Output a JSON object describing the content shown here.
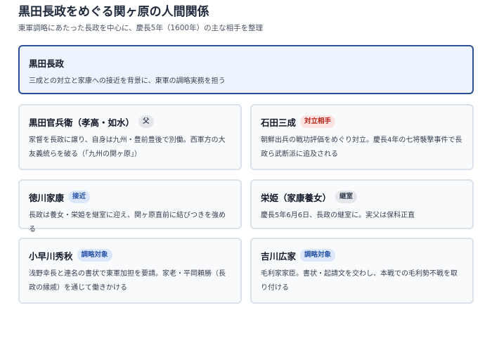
{
  "header": {
    "title": "黒田長政をめぐる関ヶ原の人間関係",
    "subtitle": "東軍調略にあたった長政を中心に、慶長5年（1600年）の主な相手を整理"
  },
  "center": {
    "name": "黒田長政",
    "desc": "三成との対立と家康への接近を背景に、東軍の調略実務を担う"
  },
  "people": [
    {
      "name": "黒田官兵衛（孝高・如水）",
      "badge": "父",
      "desc": "家督を長政に譲り、自身は九州・豊前豊後で別働。西軍方の大友義統らを破る（「九州の関ヶ原」）"
    },
    {
      "name": "石田三成",
      "badge": "対立相手",
      "desc": "朝鮮出兵の戦功評価をめぐり対立。慶長4年の七将襲撃事件で長政ら武断派に追及される"
    },
    {
      "name": "徳川家康",
      "badge": "接近",
      "desc": "長政は養女・栄姫を継室に迎え、関ヶ原直前に結びつきを強める"
    },
    {
      "name": "栄姫（家康養女）",
      "badge": "継室",
      "desc": "慶長5年6月6日、長政の継室に。実父は保科正直"
    },
    {
      "name": "小早川秀秋",
      "badge": "調略対象",
      "desc": "浅野幸長と連名の書状で東軍加担を要請。家老・平岡頼勝（長政の縁戚）を通じて働きかける"
    },
    {
      "name": "吉川広家",
      "badge": "調略対象",
      "desc": "毛利家家臣。書状・起請文を交わし、本戦での毛利勢不戦を取り付ける"
    }
  ]
}
